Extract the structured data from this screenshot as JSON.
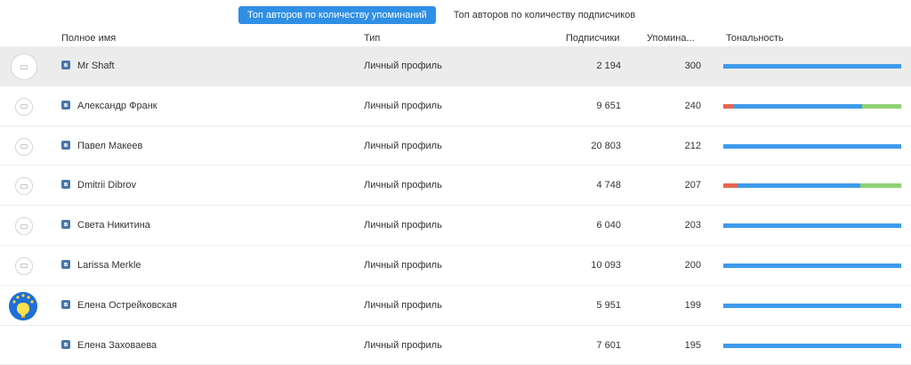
{
  "tabs": [
    {
      "label": "Топ авторов по количеству упоминаний",
      "active": true
    },
    {
      "label": "Топ авторов по количеству подписчиков",
      "active": false
    }
  ],
  "columns": {
    "name": "Полное имя",
    "type": "Тип",
    "subscribers": "Подписчики",
    "mentions": "Упомина...",
    "tone": "Тональность"
  },
  "colors": {
    "accent": "#2f8fe4",
    "negative": "#e8664f",
    "neutral": "#3f9bec",
    "positive": "#8fd175",
    "vk": "#4a76a8"
  },
  "rows": [
    {
      "name": "Mr Shaft",
      "type": "Личный профиль",
      "subscribers": "2 194",
      "mentions": "300",
      "avatar": "default-avatar-icon",
      "tone": {
        "neg": 0,
        "neu": 1,
        "pos": 0
      }
    },
    {
      "name": "Александр Франк",
      "type": "Личный профиль",
      "subscribers": "9 651",
      "mentions": "240",
      "avatar": "default-avatar-icon",
      "tone": {
        "neg": 0.06,
        "neu": 0.72,
        "pos": 0.22
      }
    },
    {
      "name": "Павел Макеев",
      "type": "Личный профиль",
      "subscribers": "20 803",
      "mentions": "212",
      "avatar": "default-avatar-icon",
      "tone": {
        "neg": 0,
        "neu": 1,
        "pos": 0
      }
    },
    {
      "name": "Dmitrii Dibrov",
      "type": "Личный профиль",
      "subscribers": "4 748",
      "mentions": "207",
      "avatar": "default-avatar-icon",
      "tone": {
        "neg": 0.08,
        "neu": 0.69,
        "pos": 0.23
      }
    },
    {
      "name": "Света Никитина",
      "type": "Личный профиль",
      "subscribers": "6 040",
      "mentions": "203",
      "avatar": "default-avatar-icon",
      "tone": {
        "neg": 0,
        "neu": 1,
        "pos": 0
      }
    },
    {
      "name": "Larissa Merkle",
      "type": "Личный профиль",
      "subscribers": "10 093",
      "mentions": "200",
      "avatar": "default-avatar-icon",
      "tone": {
        "neg": 0,
        "neu": 1,
        "pos": 0
      }
    },
    {
      "name": "Елена Острейковская",
      "type": "Личный профиль",
      "subscribers": "5 951",
      "mentions": "199",
      "avatar": "photo-avatar",
      "tone": {
        "neg": 0,
        "neu": 1,
        "pos": 0
      }
    },
    {
      "name": "Елена Заховаева",
      "type": "Личный профиль",
      "subscribers": "7 601",
      "mentions": "195",
      "avatar": "none",
      "tone": {
        "neg": 0,
        "neu": 1,
        "pos": 0
      }
    }
  ]
}
